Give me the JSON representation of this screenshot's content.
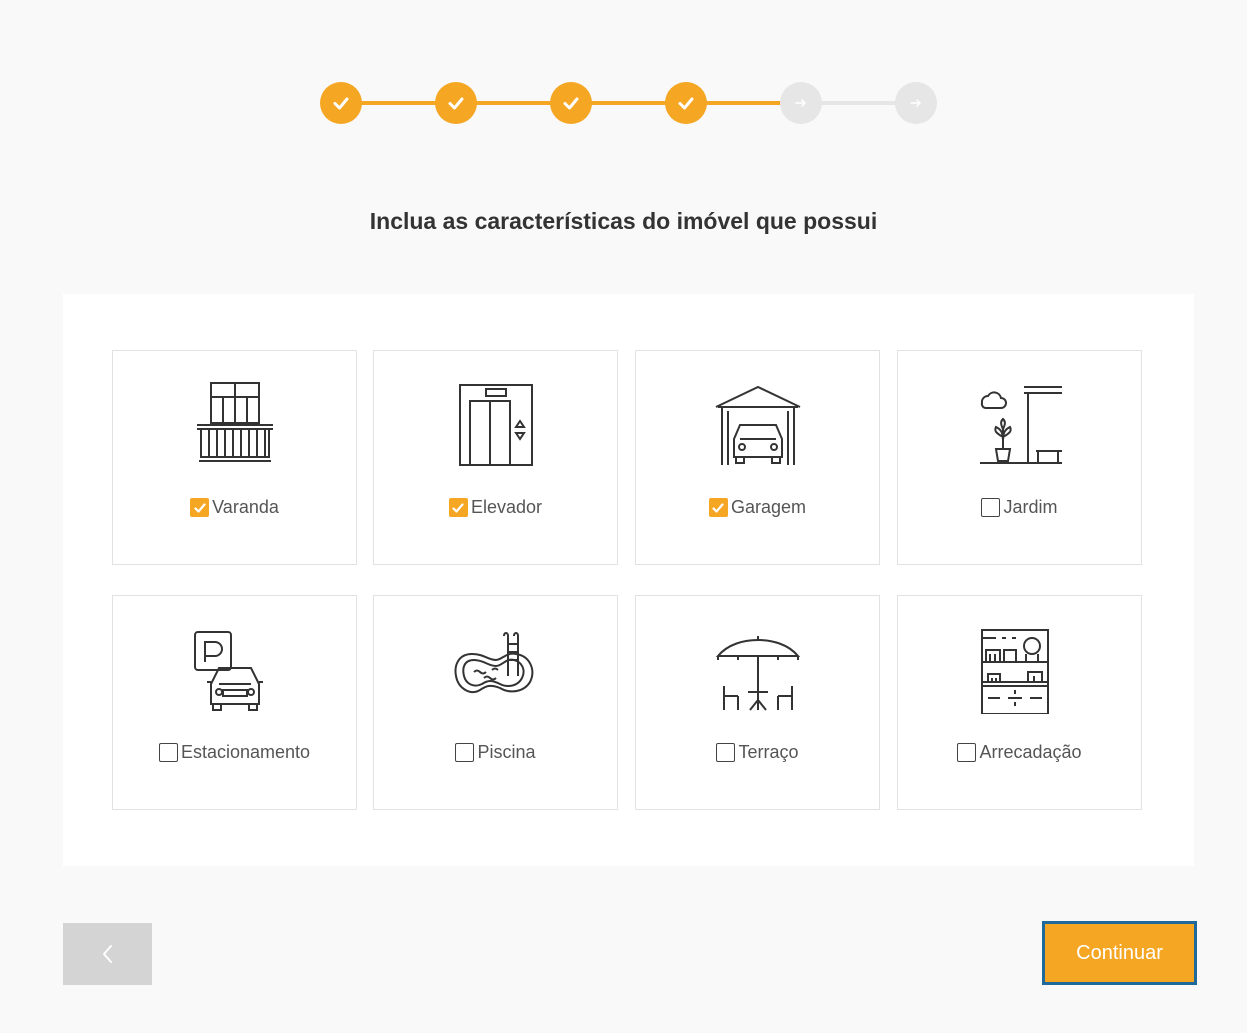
{
  "stepper": {
    "steps": [
      {
        "status": "done",
        "icon": "check-icon"
      },
      {
        "status": "done",
        "icon": "check-icon"
      },
      {
        "status": "done",
        "icon": "check-icon"
      },
      {
        "status": "done",
        "icon": "check-icon"
      },
      {
        "status": "todo",
        "icon": "arrow-right-icon"
      },
      {
        "status": "todo",
        "icon": "arrow-right-icon"
      }
    ],
    "colors": {
      "done": "#f5a623",
      "todo": "#e6e6e6"
    }
  },
  "page": {
    "title": "Inclua as características do imóvel que possui"
  },
  "features": [
    {
      "label": "Varanda",
      "checked": true,
      "icon": "balcony-icon"
    },
    {
      "label": "Elevador",
      "checked": true,
      "icon": "elevator-icon"
    },
    {
      "label": "Garagem",
      "checked": true,
      "icon": "garage-icon"
    },
    {
      "label": "Jardim",
      "checked": false,
      "icon": "garden-icon"
    },
    {
      "label": "Estacionamento",
      "checked": false,
      "icon": "parking-icon"
    },
    {
      "label": "Piscina",
      "checked": false,
      "icon": "pool-icon"
    },
    {
      "label": "Terraço",
      "checked": false,
      "icon": "terrace-icon"
    },
    {
      "label": "Arrecadação",
      "checked": false,
      "icon": "storage-icon"
    }
  ],
  "nav": {
    "back_icon": "chevron-left-icon",
    "continue_label": "Continuar"
  },
  "colors": {
    "accent": "#f5a623",
    "focus_border": "#1f6a9a",
    "back_button": "#d4d4d4"
  }
}
